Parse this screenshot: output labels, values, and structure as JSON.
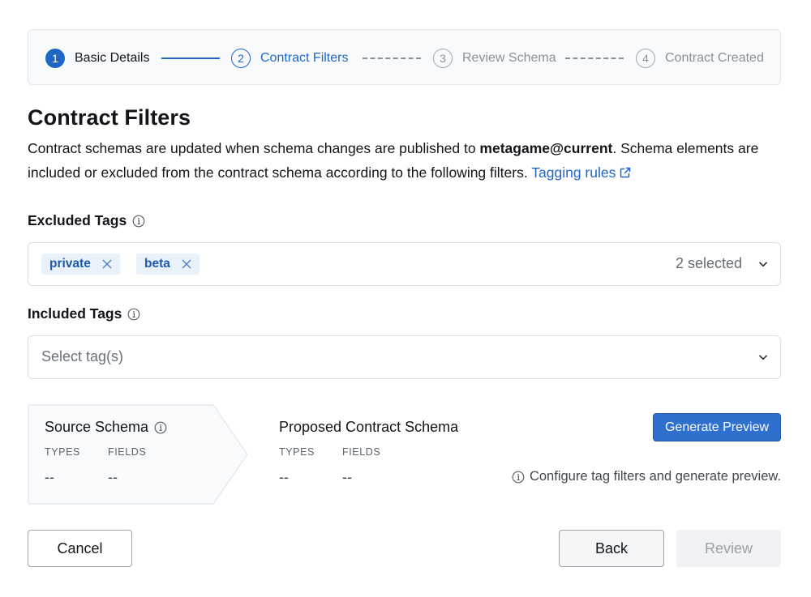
{
  "stepper": {
    "steps": [
      {
        "number": "1",
        "label": "Basic Details",
        "state": "done"
      },
      {
        "number": "2",
        "label": "Contract Filters",
        "state": "active"
      },
      {
        "number": "3",
        "label": "Review Schema",
        "state": "todo"
      },
      {
        "number": "4",
        "label": "Contract Created",
        "state": "todo"
      }
    ]
  },
  "page": {
    "title": "Contract Filters",
    "description_part1": "Contract schemas are updated when schema changes are published to ",
    "description_bold": "metagame@current",
    "description_part2": ". Schema elements are included or excluded from the contract schema according to the following filters. ",
    "tagging_rules_link": "Tagging rules"
  },
  "excluded_tags": {
    "label": "Excluded Tags",
    "chips": [
      "private",
      "beta"
    ],
    "selected_count": "2 selected"
  },
  "included_tags": {
    "label": "Included Tags",
    "placeholder": "Select tag(s)"
  },
  "schema_preview": {
    "source_title": "Source Schema",
    "proposed_title": "Proposed Contract Schema",
    "types_label": "TYPES",
    "fields_label": "FIELDS",
    "source_types": "--",
    "source_fields": "--",
    "proposed_types": "--",
    "proposed_fields": "--",
    "generate_button": "Generate Preview",
    "hint": "Configure tag filters and generate preview."
  },
  "footer": {
    "cancel": "Cancel",
    "back": "Back",
    "review": "Review"
  },
  "colors": {
    "accent": "#1f66c6",
    "panel_bg": "#f9fafc",
    "chip_bg": "#e9f1fb"
  }
}
